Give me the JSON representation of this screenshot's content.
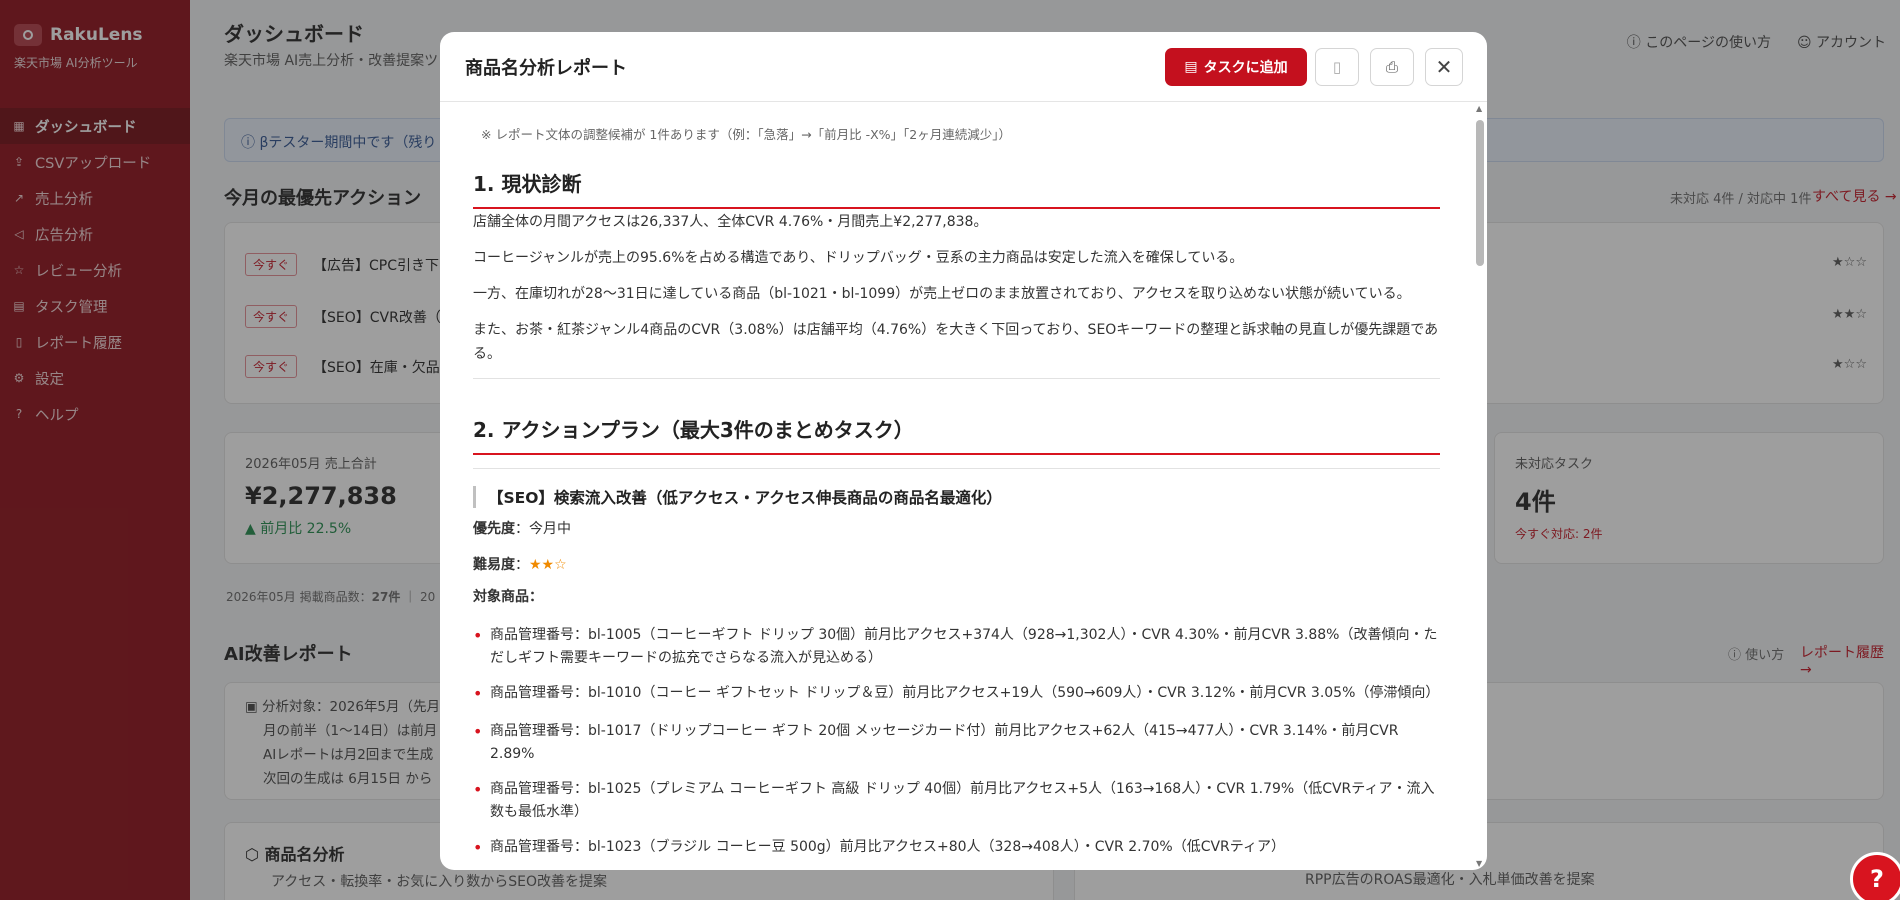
{
  "app": {
    "brand": "RakuLens",
    "brand_sub": "楽天市場 AI分析ツール"
  },
  "sidebar": {
    "items": [
      {
        "label": "ダッシュボード",
        "icon": "grid-icon"
      },
      {
        "label": "CSVアップロード",
        "icon": "upload-icon"
      },
      {
        "label": "売上分析",
        "icon": "trend-icon"
      },
      {
        "label": "広告分析",
        "icon": "megaphone-icon"
      },
      {
        "label": "レビュー分析",
        "icon": "star-icon"
      },
      {
        "label": "タスク管理",
        "icon": "clipboard-icon"
      },
      {
        "label": "レポート履歴",
        "icon": "document-icon"
      },
      {
        "label": "設定",
        "icon": "gear-icon"
      },
      {
        "label": "ヘルプ",
        "icon": "help-icon"
      }
    ]
  },
  "header": {
    "title": "ダッシュボード",
    "subtitle": "楽天市場 AI売上分析・改善提案ツ",
    "help_link": "このページの使い方",
    "account": "アカウント"
  },
  "background": {
    "beta": "βテスター期間中です（残り",
    "priority_title": "今月の最優先アクション",
    "priority_meta": "未対応 4件 / 対応中 1件",
    "see_all": "すべて見る →",
    "actions": [
      {
        "tag": "今すぐ",
        "text": "【広告】CPC引き下",
        "stars": "★☆☆"
      },
      {
        "tag": "今すぐ",
        "text": "【SEO】CVR改善（",
        "stars": "★★☆"
      },
      {
        "tag": "今すぐ",
        "text": "【SEO】在庫・欠品",
        "stars": "★☆☆"
      }
    ],
    "kpi_sales": {
      "label": "2026年05月 売上合計",
      "value": "¥2,277,838",
      "sub": "▲ 前月比 22.5%"
    },
    "kpi_tasks": {
      "label": "未対応タスク",
      "value": "4件",
      "sub": "今すぐ対応: 2件"
    },
    "listed": "2026年05月 掲載商品数：",
    "listed_count": "27件",
    "listed_tail": "20",
    "ai_title": "AI改善レポート",
    "ai_help": "使い方",
    "ai_history": "レポート履歴 →",
    "ai_lines": [
      "分析対象：2026年5月（先月",
      "月の前半（1〜14日）は前月",
      "AIレポートは月2回まで生成",
      "次回の生成は 6月15日 から"
    ],
    "product_title": "商品名分析",
    "product_sub": "アクセス・転換率・お気に入り数からSEO改善を提案",
    "rpp_sub": "RPP広告のROAS最適化・入札単価改善を提案"
  },
  "modal": {
    "title": "商品名分析レポート",
    "add_task": "タスクに追加",
    "note": "※ レポート文体の調整候補が 1件あります（例：「急落」→「前月比 -X%」「2ヶ月連続減少」）",
    "section1": "1. 現状診断",
    "s1_paragraphs": [
      "店舗全体の月間アクセスは26,337人、全体CVR 4.76%・月間売上¥2,277,838。",
      "コーヒージャンルが売上の95.6%を占める構造であり、ドリップバッグ・豆系の主力商品は安定した流入を確保している。",
      "一方、在庫切れが28〜31日に達している商品（bl-1021・bl-1099）が売上ゼロのまま放置されており、アクセスを取り込めない状態が続いている。",
      "また、お茶・紅茶ジャンル4商品のCVR（3.08%）は店舗平均（4.76%）を大きく下回っており、SEOキーワードの整理と訴求軸の見直しが優先課題である。"
    ],
    "section2": "2. アクションプラン（最大3件のまとめタスク）",
    "task_title": "【SEO】検索流入改善（低アクセス・アクセス伸長商品の商品名最適化）",
    "priority_label": "優先度",
    "priority_value": "今月中",
    "difficulty_label": "難易度",
    "difficulty_value": "★★☆",
    "target_label": "対象商品：",
    "targets": [
      "商品管理番号：bl-1005（コーヒーギフト ドリップ 30個）前月比アクセス+374人（928→1,302人）・CVR 4.30%・前月CVR 3.88%（改善傾向・ただしギフト需要キーワードの拡充でさらなる流入が見込める）",
      "商品管理番号：bl-1010（コーヒー ギフトセット ドリップ＆豆）前月比アクセス+19人（590→609人）・CVR 3.12%・前月CVR 3.05%（停滞傾向）",
      "商品管理番号：bl-1017（ドリップコーヒー ギフト 20個 メッセージカード付）前月比アクセス+62人（415→477人）・CVR 3.14%・前月CVR 2.89%",
      "商品管理番号：bl-1025（プレミアム コーヒーギフト 高級 ドリップ 40個）前月比アクセス+5人（163→168人）・CVR 1.79%（低CVRティア・流入数も最低水準）",
      "商品管理番号：bl-1023（ブラジル コーヒー豆 500g）前月比アクセス+80人（328→408人）・CVR 2.70%（低CVRティア）"
    ]
  },
  "fab": "?"
}
